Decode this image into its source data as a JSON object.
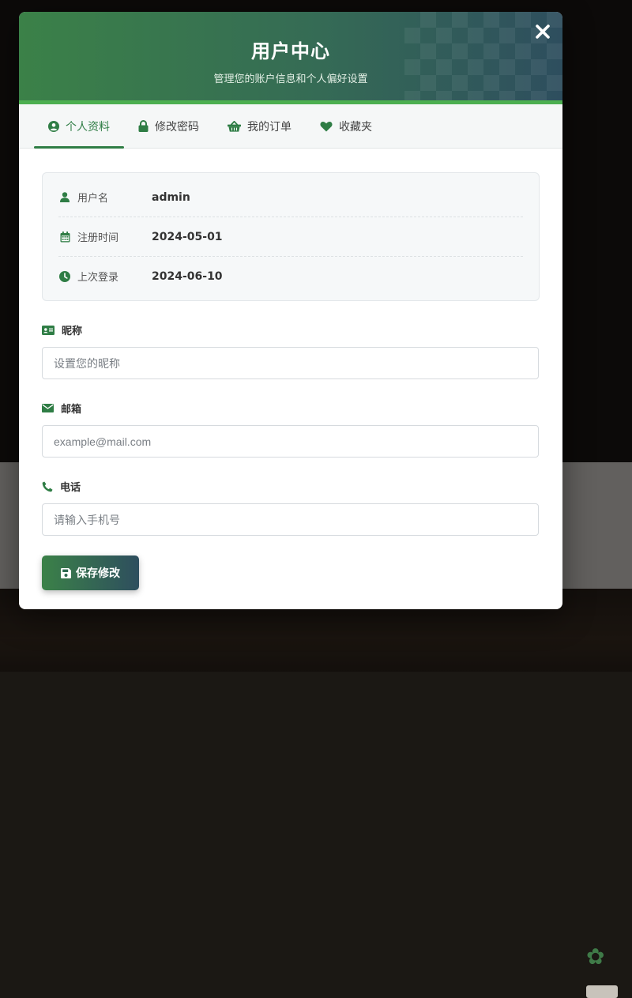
{
  "modal": {
    "title": "用户中心",
    "subtitle": "管理您的账户信息和个人偏好设置",
    "close_icon": "close-icon"
  },
  "tabs": [
    {
      "label": "个人资料",
      "icon": "user-circle-icon",
      "active": true
    },
    {
      "label": "修改密码",
      "icon": "lock-icon",
      "active": false
    },
    {
      "label": "我的订单",
      "icon": "basket-icon",
      "active": false
    },
    {
      "label": "收藏夹",
      "icon": "heart-icon",
      "active": false
    }
  ],
  "info": [
    {
      "label": "用户名",
      "value": "admin",
      "icon": "user-icon"
    },
    {
      "label": "注册时间",
      "value": "2024-05-01",
      "icon": "calendar-icon"
    },
    {
      "label": "上次登录",
      "value": "2024-06-10",
      "icon": "clock-icon"
    }
  ],
  "fields": {
    "nickname": {
      "label": "昵称",
      "placeholder": "设置您的昵称",
      "value": "",
      "icon": "id-card-icon"
    },
    "email": {
      "label": "邮箱",
      "placeholder": "example@mail.com",
      "value": "",
      "icon": "envelope-icon"
    },
    "phone": {
      "label": "电话",
      "placeholder": "请输入手机号",
      "value": "",
      "icon": "phone-icon"
    }
  },
  "save_button": {
    "label": "保存修改",
    "icon": "save-icon"
  },
  "colors": {
    "accent": "#2f7d45",
    "header_gradient_start": "#3b8148",
    "header_gradient_end": "#2e4e5e",
    "header_border": "#4caf50"
  }
}
